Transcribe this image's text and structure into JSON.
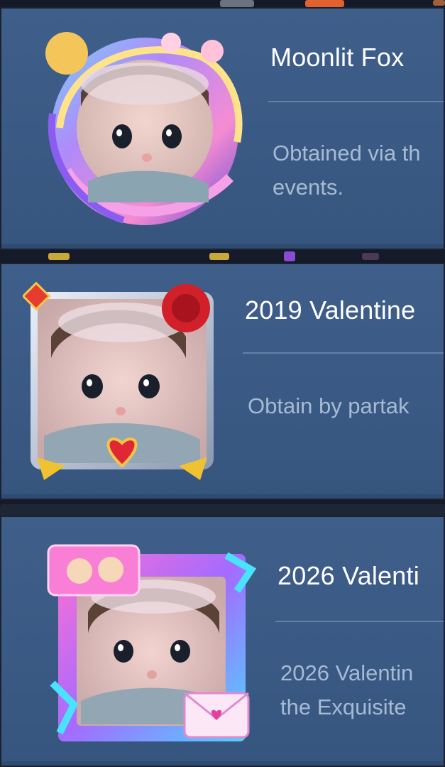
{
  "colors": {
    "card_bg": "#3b5b86",
    "title_text": "#ffffff",
    "desc_text": "#a7bad3",
    "divider": "#6f8fb8",
    "separator": "#141a27"
  },
  "frames": [
    {
      "title": "Moonlit Fox",
      "description_lines": [
        "Obtained via th",
        "events."
      ],
      "icon": "moonlit-fox-avatar-frame"
    },
    {
      "title": "2019 Valentine",
      "description_lines": [
        "Obtain by partak"
      ],
      "icon": "2019-valentine-avatar-frame"
    },
    {
      "title": "2026 Valenti",
      "description_lines": [
        "2026 Valentin",
        "the Exquisite"
      ],
      "icon": "2026-valentine-avatar-frame"
    }
  ]
}
